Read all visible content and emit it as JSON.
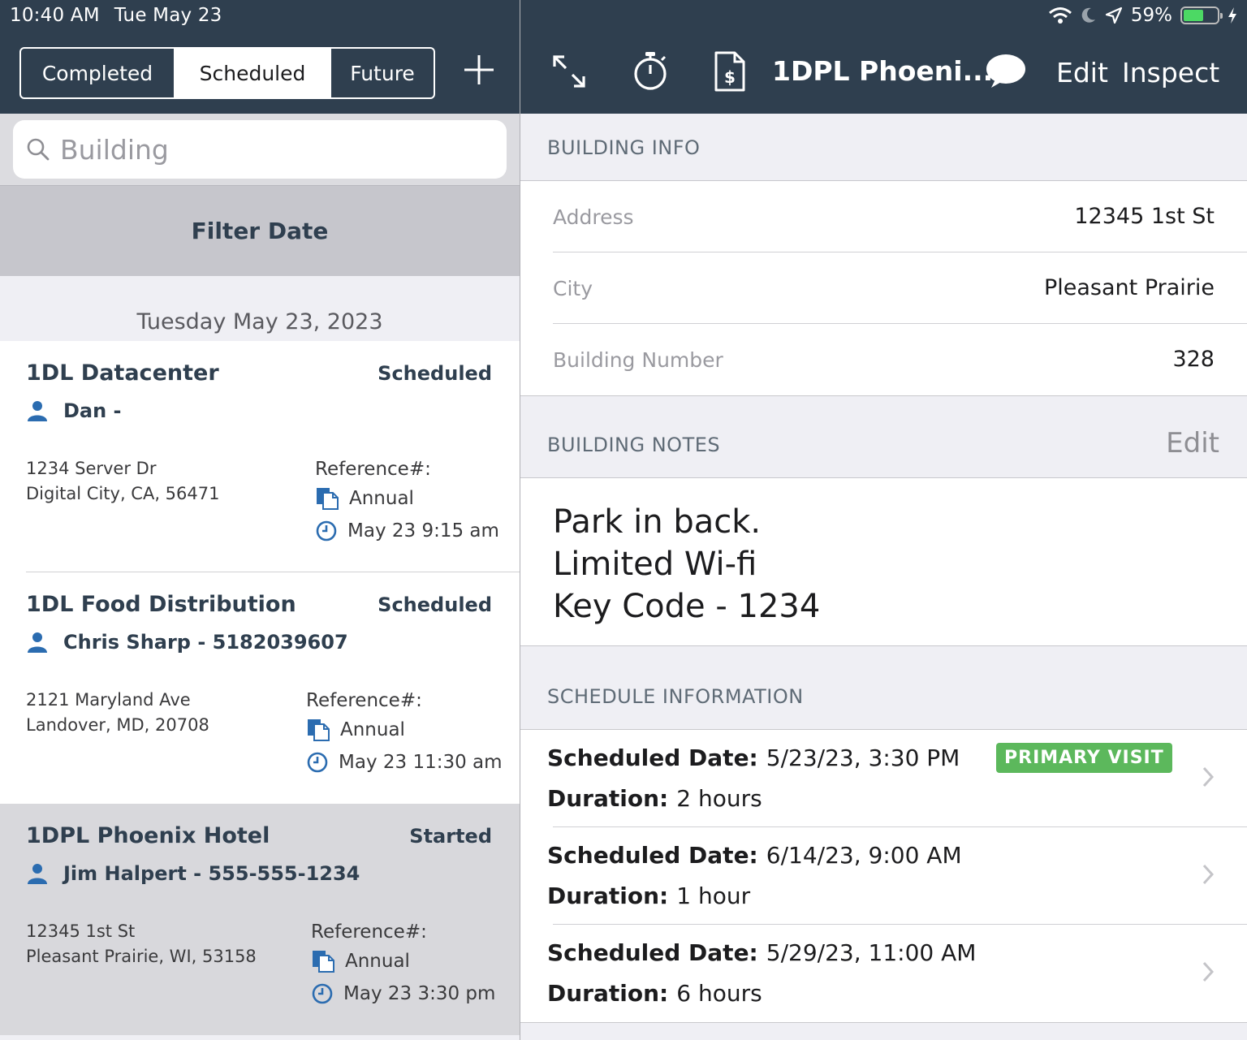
{
  "status_bar": {
    "time": "10:40 AM",
    "date": "Tue May 23",
    "battery": "59%"
  },
  "left": {
    "segments": [
      "Completed",
      "Scheduled",
      "Future"
    ],
    "active_segment": "Scheduled",
    "search": {
      "placeholder": "Building"
    },
    "filter_label": "Filter Date",
    "day_header": "Tuesday May 23, 2023",
    "jobs": [
      {
        "title": "1DL Datacenter",
        "status": "Scheduled",
        "contact": "Dan -",
        "address_line1": "1234 Server Dr",
        "address_line2": "Digital City, CA, 56471",
        "reference_label": "Reference#:",
        "type": "Annual",
        "time": "May 23 9:15 am"
      },
      {
        "title": "1DL Food Distribution",
        "status": "Scheduled",
        "contact": "Chris Sharp - 5182039607",
        "address_line1": "2121 Maryland Ave",
        "address_line2": "Landover, MD, 20708",
        "reference_label": "Reference#:",
        "type": "Annual",
        "time": "May 23 11:30 am"
      },
      {
        "title": "1DPL Phoenix Hotel",
        "status": "Started",
        "contact": "Jim Halpert - 555-555-1234",
        "address_line1": "12345 1st St",
        "address_line2": "Pleasant Prairie, WI, 53158",
        "reference_label": "Reference#:",
        "type": "Annual",
        "time": "May 23 3:30 pm"
      }
    ]
  },
  "right": {
    "title": "1DPL Phoeni...",
    "edit_label": "Edit",
    "inspect_label": "Inspect",
    "icons": [
      "expand-icon",
      "stopwatch-icon",
      "invoice-icon",
      "chat-icon"
    ],
    "building_info": {
      "heading": "BUILDING INFO",
      "rows": [
        {
          "key": "Address",
          "value": "12345 1st St"
        },
        {
          "key": "City",
          "value": "Pleasant Prairie"
        },
        {
          "key": "Building Number",
          "value": "328"
        }
      ]
    },
    "building_notes": {
      "heading": "BUILDING NOTES",
      "edit_label": "Edit",
      "lines": [
        "Park in back.",
        "Limited Wi-fi",
        "Key Code - 1234"
      ]
    },
    "schedule": {
      "heading": "SCHEDULE INFORMATION",
      "date_label": "Scheduled Date:",
      "duration_label": "Duration:",
      "primary_badge": "PRIMARY VISIT",
      "rows": [
        {
          "date": "5/23/23, 3:30 PM",
          "duration": "2 hours"
        },
        {
          "date": "6/14/23, 9:00 AM",
          "duration": "1 hour"
        },
        {
          "date": "5/29/23, 11:00 AM",
          "duration": "6 hours"
        }
      ]
    }
  },
  "colors": {
    "header_bg": "#2f3f4f",
    "primary_green": "#5cb85c",
    "battery_green": "#4cd964",
    "accent_blue": "#2b6cb0"
  }
}
